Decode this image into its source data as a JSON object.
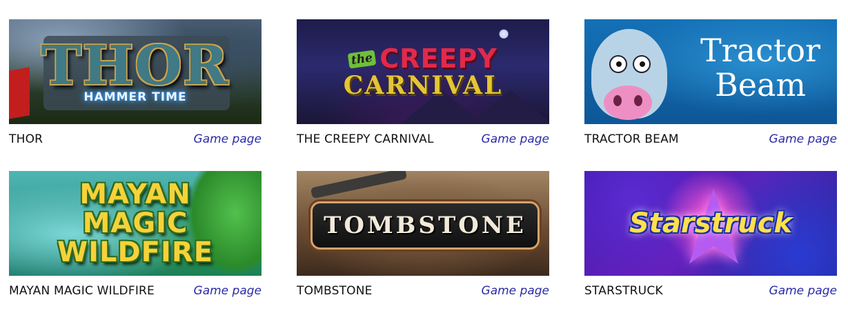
{
  "games": [
    {
      "title": "THOR",
      "link": "Game page",
      "logo_main": "THOR",
      "logo_sub": "HAMMER TIME"
    },
    {
      "title": "THE CREEPY CARNIVAL",
      "link": "Game page",
      "logo_small": "the",
      "logo_main": "CREEPY",
      "logo_sub": "CARNIVAL"
    },
    {
      "title": "TRACTOR BEAM",
      "link": "Game page",
      "logo_line1": "Tractor",
      "logo_line2": "Beam"
    },
    {
      "title": "MAYAN MAGIC WILDFIRE",
      "link": "Game page",
      "logo_line1": "MAYAN",
      "logo_line2": "MAGIC",
      "logo_line3": "WILDFIRE"
    },
    {
      "title": "TOMBSTONE",
      "link": "Game page",
      "logo_main": "TOMBSTONE"
    },
    {
      "title": "STARSTRUCK",
      "link": "Game page",
      "logo_main": "Starstruck"
    }
  ],
  "colors": {
    "link": "#2a2aa8",
    "title": "#111111"
  }
}
